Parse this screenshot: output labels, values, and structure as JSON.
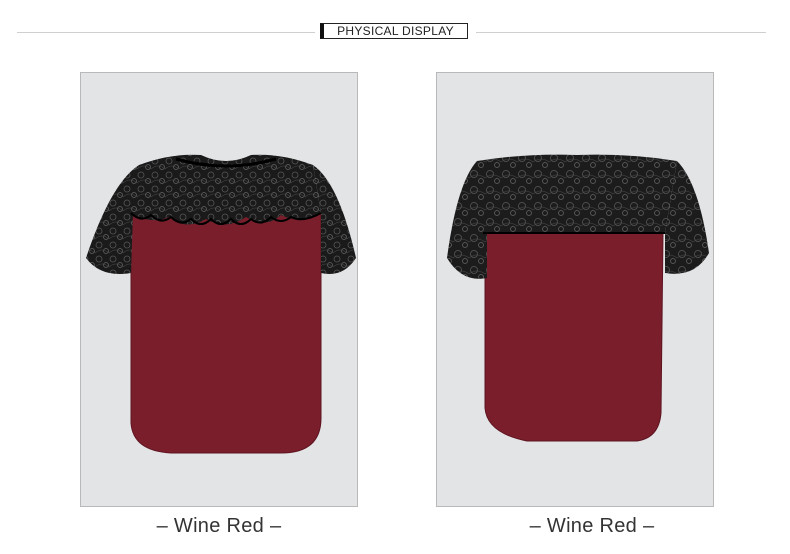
{
  "header": {
    "title": "PHYSICAL DISPLAY"
  },
  "products": [
    {
      "view": "front",
      "caption": "– Wine Red –"
    },
    {
      "view": "back",
      "caption": "– Wine Red –"
    }
  ],
  "colors": {
    "wine_red": "#7a1e2c",
    "lace": "#111111",
    "backdrop": "#e3e4e6"
  }
}
